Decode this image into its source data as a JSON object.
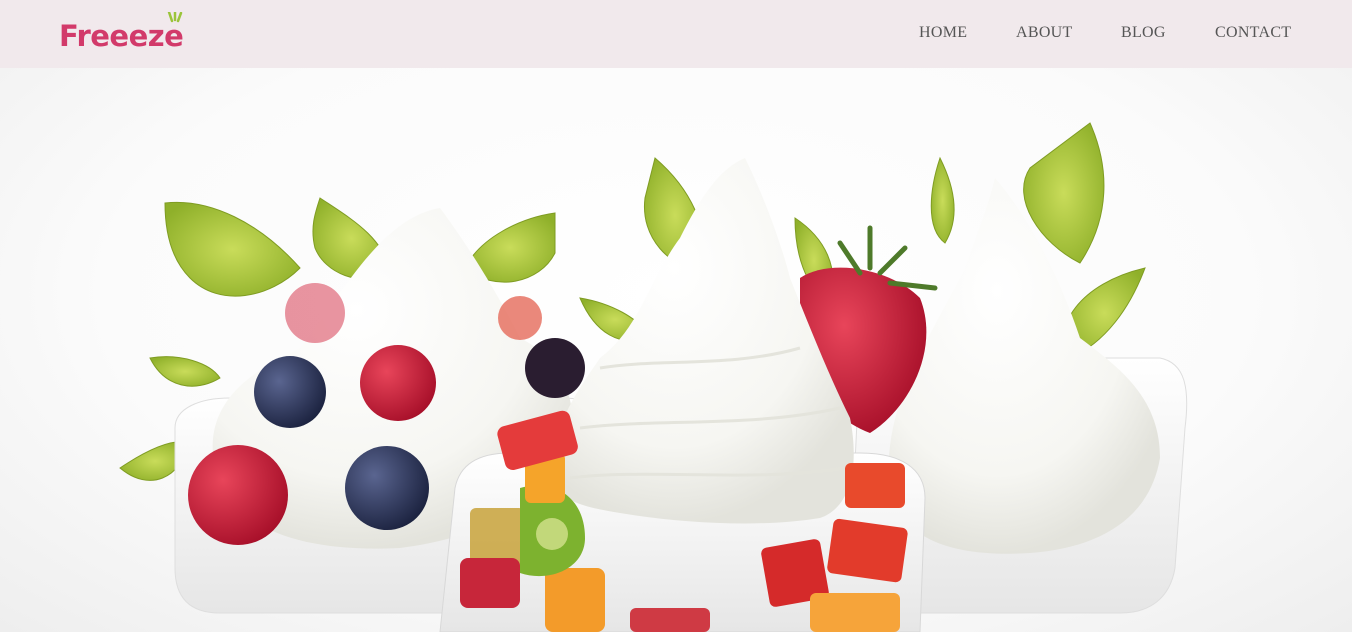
{
  "brand": {
    "name": "Freeeze",
    "color": "#d23a6a",
    "accent": "#9bc43a"
  },
  "nav": {
    "items": [
      {
        "label": "HOME"
      },
      {
        "label": "ABOUT"
      },
      {
        "label": "BLOG"
      },
      {
        "label": "CONTACT"
      }
    ]
  },
  "hero": {
    "image": "frozen-yogurt-cups-with-fruit"
  }
}
